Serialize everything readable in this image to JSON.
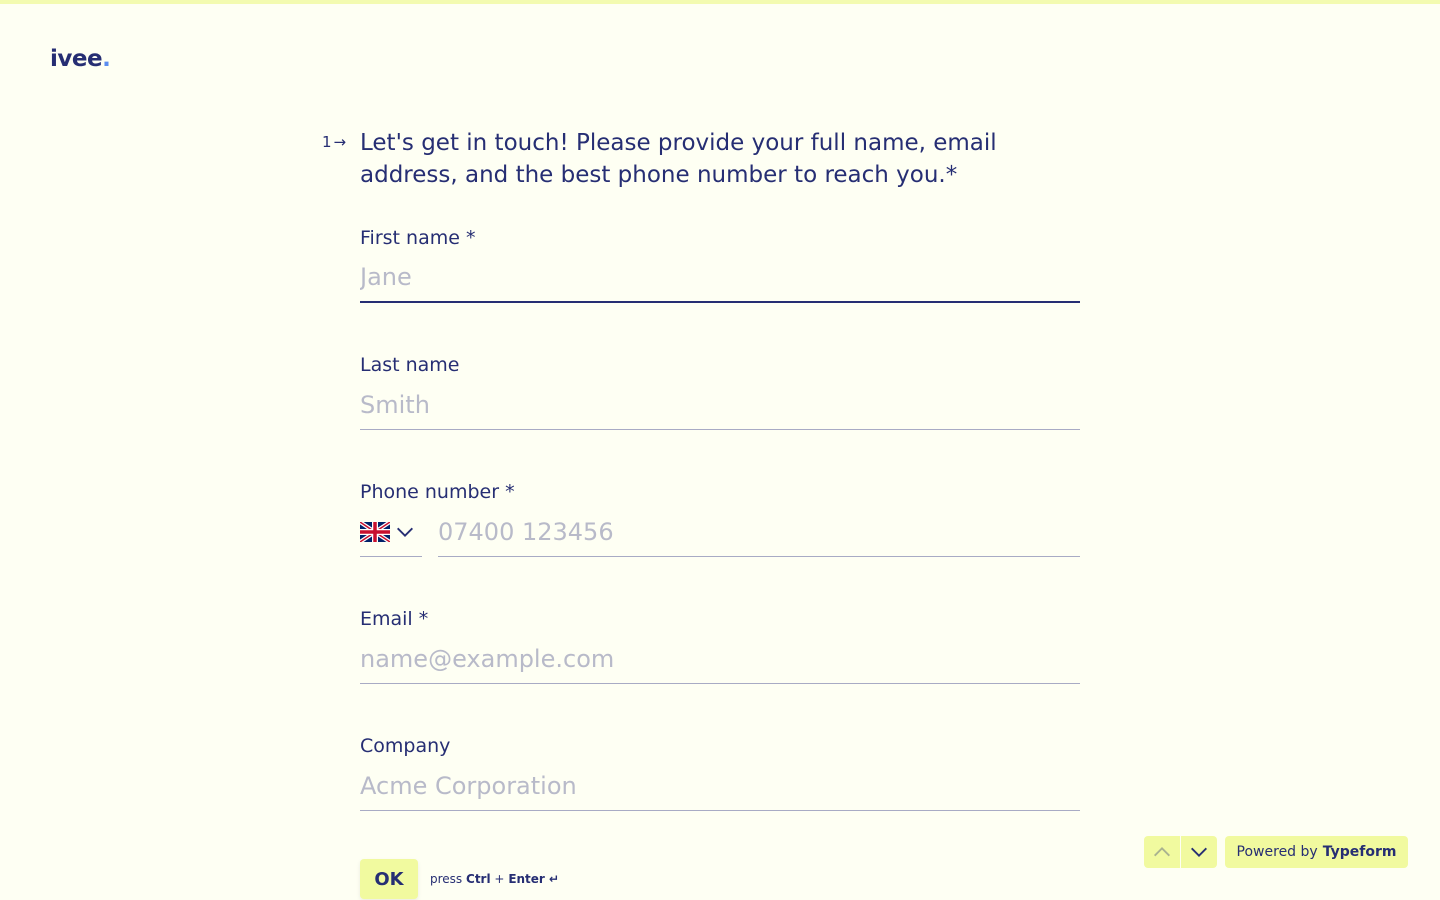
{
  "brand": {
    "logo_text": "ivee",
    "logo_dot": "."
  },
  "question": {
    "number": "1",
    "arrow": "→",
    "text": "Let's get in touch! Please provide your full name, email address, and the best phone number to reach you.*"
  },
  "fields": {
    "first_name": {
      "label": "First name *",
      "placeholder": "Jane",
      "value": ""
    },
    "last_name": {
      "label": "Last name",
      "placeholder": "Smith",
      "value": ""
    },
    "phone": {
      "label": "Phone number *",
      "placeholder": "07400 123456",
      "value": "",
      "country": "flag-uk-icon"
    },
    "email": {
      "label": "Email *",
      "placeholder": "name@example.com",
      "value": ""
    },
    "company": {
      "label": "Company",
      "placeholder": "Acme Corporation",
      "value": ""
    }
  },
  "actions": {
    "ok_label": "OK",
    "hint_press": "press",
    "hint_key1": "Ctrl",
    "hint_plus": "+",
    "hint_key2": "Enter ↵"
  },
  "footer": {
    "powered_prefix": "Powered by",
    "powered_brand": "Typeform"
  },
  "colors": {
    "background": "#fefff3",
    "text": "#262e73",
    "accent": "#f1fa9f",
    "logo_dot": "#5b8def"
  }
}
